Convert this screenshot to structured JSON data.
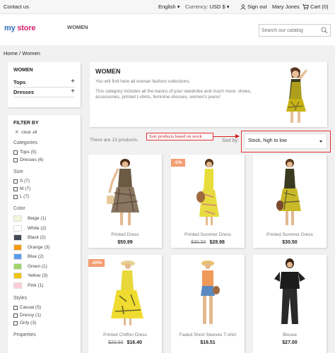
{
  "topbar": {
    "contact": "Contact us",
    "language": "English",
    "currency_label": "Currency:",
    "currency_value": "USD $",
    "sign_out": "Sign out",
    "username": "Mary Jones",
    "cart": "Cart (0)"
  },
  "header": {
    "logo_part1": "my",
    "logo_part2": " store",
    "nav_women": "WOMEN",
    "search_placeholder": "Search our catalog"
  },
  "breadcrumb": "Home  /  Women",
  "sidebar": {
    "category_title": "WOMEN",
    "categories": [
      {
        "label": "Tops",
        "icon": "+"
      },
      {
        "label": "Dresses",
        "icon": "+"
      }
    ],
    "filter_title": "FILTER BY",
    "clear_all": "clear all",
    "groups": {
      "categories_title": "Categories",
      "categories": [
        "Tops (5)",
        "Dresses (6)"
      ],
      "size_title": "Size",
      "sizes": [
        "S (7)",
        "M (7)",
        "L (7)"
      ],
      "color_title": "Color",
      "colors": [
        {
          "label": "Beige (1)",
          "hex": "#f5f5dc"
        },
        {
          "label": "White (2)",
          "hex": "#ffffff"
        },
        {
          "label": "Black (2)",
          "hex": "#434a54"
        },
        {
          "label": "Orange (3)",
          "hex": "#f39c11"
        },
        {
          "label": "Blue (2)",
          "hex": "#5d9cec"
        },
        {
          "label": "Green (1)",
          "hex": "#a0d468"
        },
        {
          "label": "Yellow (3)",
          "hex": "#f1c40f"
        },
        {
          "label": "Pink (1)",
          "hex": "#fcccd8"
        }
      ],
      "styles_title": "Styles",
      "styles": [
        "Casual (5)",
        "Dressy (1)",
        "Girly (3)"
      ],
      "properties_title": "Properties"
    }
  },
  "banner": {
    "title": "WOMEN",
    "line1": "You will find here all woman fashion collections.",
    "line2": "This category includes all the basics of your wardrobe and much more: shoes, accessories, printed t-shirts, feminine dresses, women's jeans!"
  },
  "listing": {
    "count_text": "There are 13 products.",
    "annotation": "Sort products based on stock",
    "sort_by_label": "Sort by:",
    "sort_value": "Stock, high to low"
  },
  "products": [
    {
      "name": "Printed Dress",
      "old_price": "",
      "price": "$50.99",
      "badge": ""
    },
    {
      "name": "Printed Summer Dress",
      "old_price": "$30.50",
      "price": "$28.98",
      "badge": "-5%"
    },
    {
      "name": "Printed Summer Dress",
      "old_price": "",
      "price": "$30.50",
      "badge": ""
    },
    {
      "name": "Printed Chiffon Dress",
      "old_price": "$20.50",
      "price": "$16.40",
      "badge": "-20%"
    },
    {
      "name": "Faded Short Sleeves T-shirt",
      "old_price": "",
      "price": "$16.51",
      "badge": ""
    },
    {
      "name": "Blouse",
      "old_price": "",
      "price": "$27.00",
      "badge": ""
    }
  ],
  "colors": {
    "accent_red": "#e03030",
    "badge": "#f39d72",
    "logo_pink": "#d6246d",
    "logo_blue": "#2a6ebb"
  }
}
